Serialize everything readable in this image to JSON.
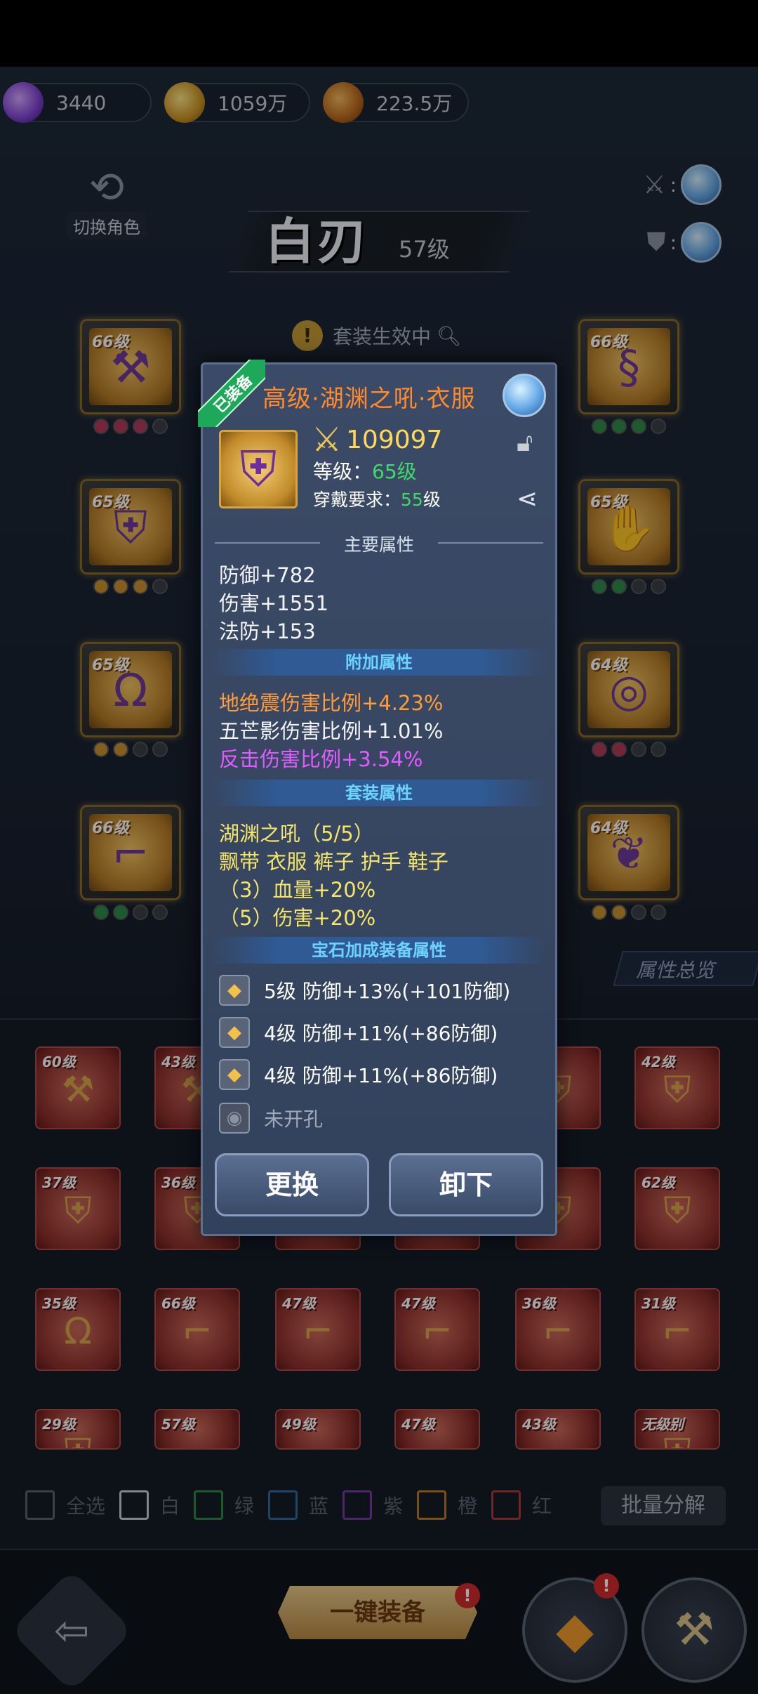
{
  "currency": {
    "gems": "3440",
    "gold": "1059万",
    "bag": "223.5万"
  },
  "header": {
    "switch_role": "切换角色",
    "hero_name": "白刃",
    "hero_level": "57级",
    "set_active": "套装生效中"
  },
  "equip_slots": [
    {
      "level": "66级"
    },
    {
      "level": "66级"
    },
    {
      "level": "65级"
    },
    {
      "level": "65级"
    },
    {
      "level": "65级"
    },
    {
      "level": "64级"
    },
    {
      "level": "66级"
    },
    {
      "level": "64级"
    }
  ],
  "bag_items": [
    {
      "level": "60级"
    },
    {
      "level": "43级"
    },
    {
      "level": ""
    },
    {
      "level": ""
    },
    {
      "level": ""
    },
    {
      "level": "42级"
    },
    {
      "level": "37级"
    },
    {
      "level": "36级"
    },
    {
      "level": ""
    },
    {
      "level": ""
    },
    {
      "level": ""
    },
    {
      "level": "62级"
    },
    {
      "level": "35级"
    },
    {
      "level": "66级"
    },
    {
      "level": "47级"
    },
    {
      "level": "47级"
    },
    {
      "level": "36级"
    },
    {
      "level": "31级"
    },
    {
      "level": "29级"
    },
    {
      "level": "57级"
    },
    {
      "level": "49级"
    },
    {
      "level": "47级"
    },
    {
      "level": "43级"
    },
    {
      "level": "无级别"
    }
  ],
  "filters": [
    "全选",
    "白",
    "绿",
    "蓝",
    "紫",
    "橙",
    "红"
  ],
  "filter_colors": [
    "#5a6474",
    "#c8ccd4",
    "#2f8a4a",
    "#2f6aa0",
    "#7a3aa8",
    "#c07a20",
    "#b03a3a"
  ],
  "batch_button": "批量分解",
  "attr_overview": "属性总览",
  "equip_all": "一键装备",
  "popup": {
    "ribbon": "已装备",
    "title": "高级·湖渊之吼·衣服",
    "power": "109097",
    "level_label": "等级：",
    "level_value": "65级",
    "req_label": "穿戴要求：",
    "req_value": "55",
    "req_unit": "级",
    "main_title": "主要属性",
    "main_stats": [
      "防御+782",
      "伤害+1551",
      "法防+153"
    ],
    "extra_title": "附加属性",
    "extra_stats": [
      "地绝震伤害比例+4.23%",
      "五芒影伤害比例+1.01%",
      "反击伤害比例+3.54%"
    ],
    "set_title": "套装属性",
    "set_name": "湖渊之吼（5/5）",
    "set_parts": "飘带 衣服 裤子 护手 鞋子",
    "set_bonus_3": "（3）血量+20%",
    "set_bonus_5": "（5）伤害+20%",
    "gem_title": "宝石加成装备属性",
    "gems": [
      "5级  防御+13%(+101防御)",
      "4级  防御+11%(+86防御)",
      "4级  防御+11%(+86防御)"
    ],
    "gem_empty": "未开孔",
    "btn_replace": "更换",
    "btn_unequip": "卸下"
  },
  "colors": {
    "title_orange": "#ff8a2b",
    "power_yellow": "#ffd95a",
    "stat_orange": "#ff9b3a",
    "stat_purple": "#e15cff",
    "set_yellow": "#f4e56a",
    "section_blue": "#6cd4ff",
    "ribbon_green": "#1ea85a"
  }
}
